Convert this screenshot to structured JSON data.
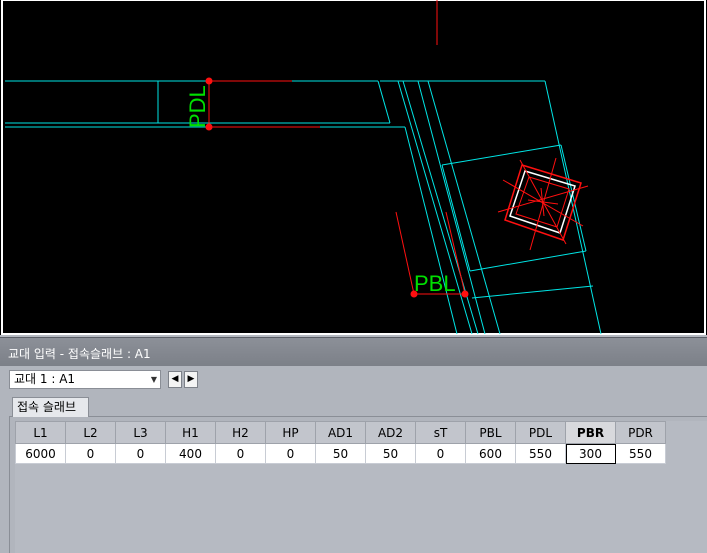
{
  "viewport": {
    "labels": {
      "pdl": "PDL",
      "pbl": "PBL"
    },
    "colors": {
      "background": "#000000",
      "cyan": "#00e5e5",
      "red": "#ff1010",
      "green": "#00e000"
    }
  },
  "panel": {
    "title": "교대 입력 - 접속슬래브 : A1",
    "selector": {
      "value": "교대 1 : A1",
      "prev_icon": "◀",
      "next_icon": "▶"
    },
    "tab_label": "접속 슬래브"
  },
  "table": {
    "columns": [
      "L1",
      "L2",
      "L3",
      "H1",
      "H2",
      "HP",
      "AD1",
      "AD2",
      "sT",
      "PBL",
      "PDL",
      "PBR",
      "PDR"
    ],
    "rows": [
      [
        "6000",
        "0",
        "0",
        "400",
        "0",
        "0",
        "50",
        "50",
        "0",
        "600",
        "550",
        "300",
        "550"
      ]
    ],
    "selected_column": "PBR"
  }
}
